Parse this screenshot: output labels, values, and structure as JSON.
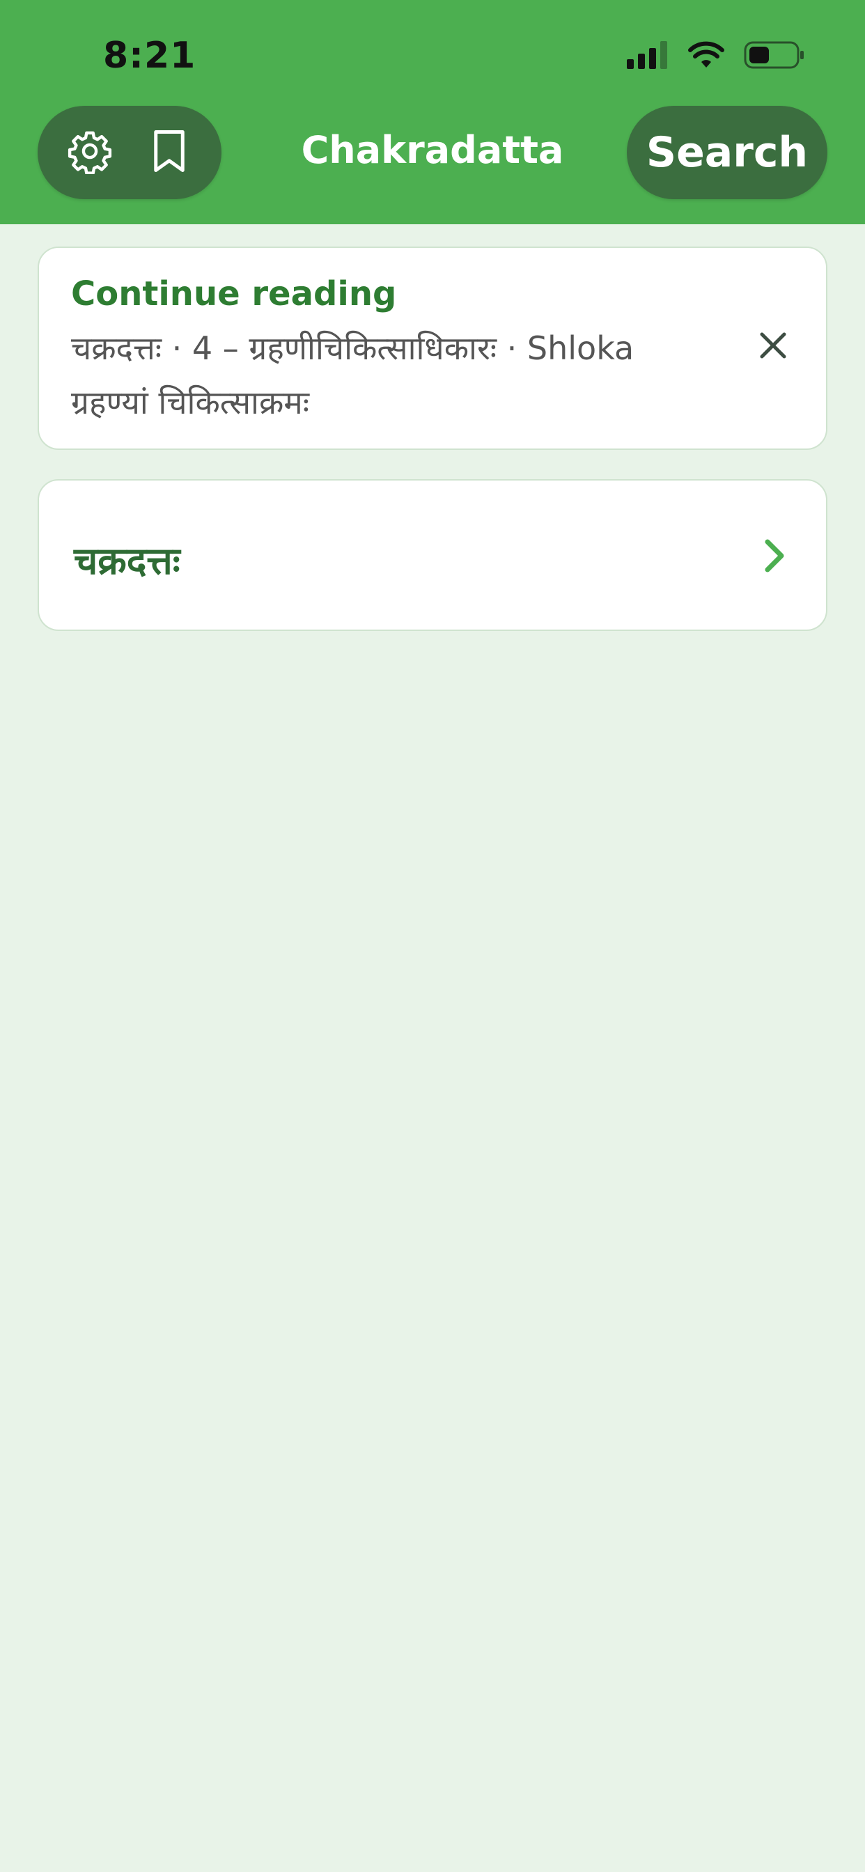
{
  "status_bar": {
    "time": "8:21"
  },
  "header": {
    "title": "Chakradatta",
    "search_label": "Search",
    "icons": [
      "gear-icon",
      "bookmark-icon"
    ]
  },
  "continue_reading": {
    "title": "Continue reading",
    "line1": "चक्रदत्तः · 4 – ग्रहणीचिकित्साधिकारः · Shloka",
    "line2": "ग्रहण्यां चिकित्साक्रमः"
  },
  "books": [
    {
      "title": "चक्रदत्तः"
    }
  ],
  "colors": {
    "header": "#4caf50",
    "pill": "#3b6e3f",
    "background": "#e8f3e8",
    "accent": "#2e7d32"
  }
}
